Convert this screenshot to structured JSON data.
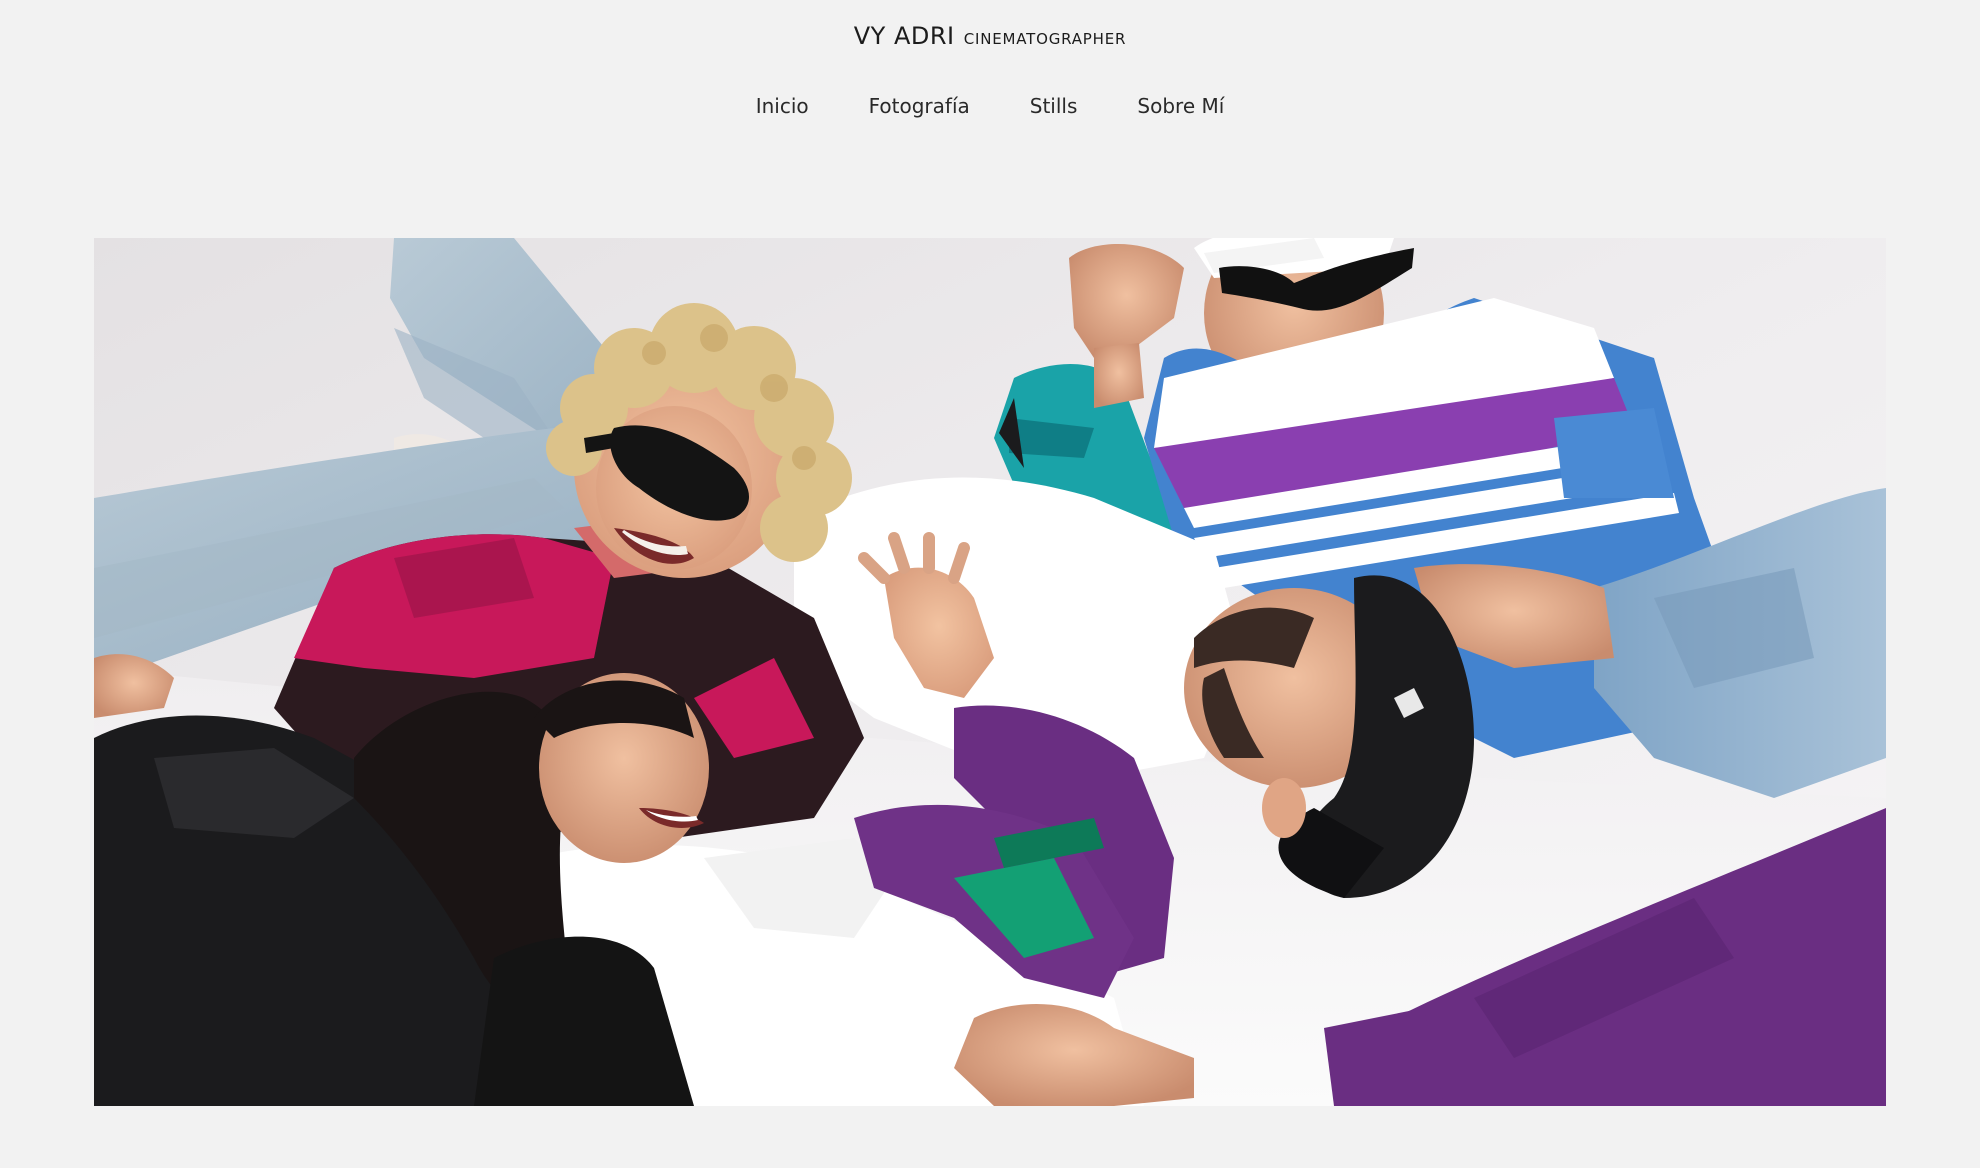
{
  "site": {
    "brand_name": "VY ADRI",
    "brand_tagline": "CINEMATOGRAPHER"
  },
  "nav": {
    "items": [
      {
        "label": "Inicio"
      },
      {
        "label": "Fotografía"
      },
      {
        "label": "Stills"
      },
      {
        "label": "Sobre Mí"
      }
    ]
  },
  "hero": {
    "image": "group-photo",
    "colors": {
      "background": "#f2f2f2",
      "backdrop": "#eceaec",
      "purple": "#6a2e82",
      "blue": "#3f7fd0",
      "magenta": "#c8185a",
      "teal": "#1aa3a8",
      "black": "#1b1b1d",
      "denim": "#a8bccb"
    }
  }
}
